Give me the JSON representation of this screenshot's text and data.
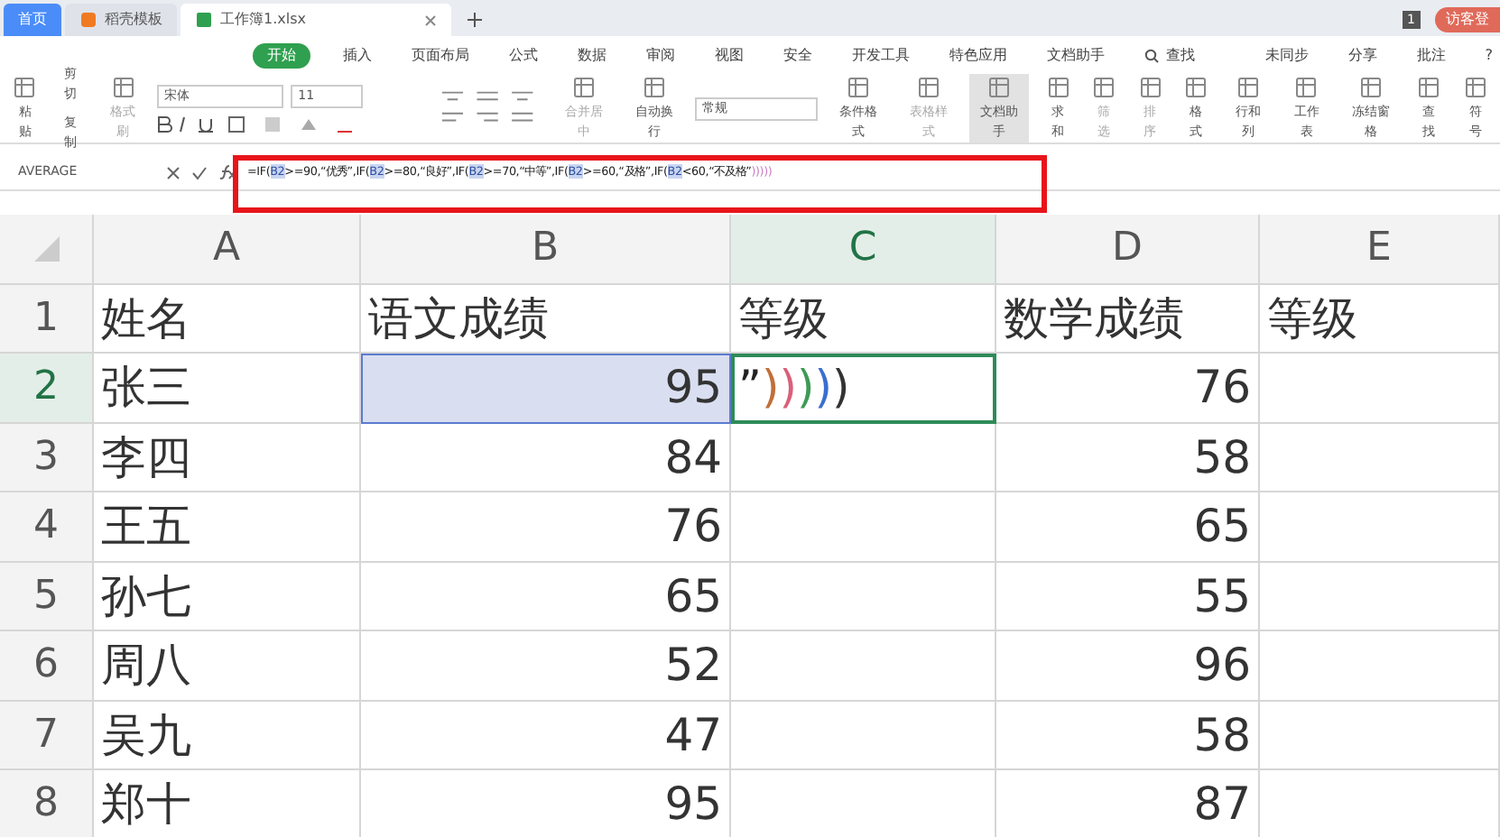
{
  "tabs": [
    {
      "label": "首页",
      "selected": false,
      "kind": "home"
    },
    {
      "label": "稻壳模板",
      "selected": false,
      "kind": "doc"
    },
    {
      "label": "工作簿1.xlsx",
      "selected": true,
      "kind": "sheet"
    }
  ],
  "account": {
    "badge": "1",
    "login": "访客登"
  },
  "menu": [
    {
      "label": "开始",
      "selected": true
    },
    {
      "label": "插入",
      "selected": false
    },
    {
      "label": "页面布局",
      "selected": false
    },
    {
      "label": "公式",
      "selected": false
    },
    {
      "label": "数据",
      "selected": false
    },
    {
      "label": "审阅",
      "selected": false
    },
    {
      "label": "视图",
      "selected": false
    },
    {
      "label": "安全",
      "selected": false
    },
    {
      "label": "开发工具",
      "selected": false
    },
    {
      "label": "特色应用",
      "selected": false
    },
    {
      "label": "文档助手",
      "selected": false
    }
  ],
  "search_menu": "查找",
  "menu_right": [
    "未同步",
    "分享",
    "批注",
    "?"
  ],
  "clipboard": {
    "paste": "粘贴",
    "cut": "剪切",
    "copy": "复制",
    "painter": "格式刷"
  },
  "font": {
    "name": "宋体",
    "size": "11"
  },
  "align": {
    "merge": "合并居中",
    "wrap": "自动换行"
  },
  "number_format": "常规",
  "tools": [
    {
      "label": "条件格式",
      "selected": false,
      "disabled": false
    },
    {
      "label": "表格样式",
      "selected": false,
      "disabled": true
    },
    {
      "label": "文档助手",
      "selected": true,
      "disabled": false
    },
    {
      "label": "求和",
      "selected": false,
      "disabled": false
    },
    {
      "label": "筛选",
      "selected": false,
      "disabled": true
    },
    {
      "label": "排序",
      "selected": false,
      "disabled": true
    },
    {
      "label": "格式",
      "selected": false,
      "disabled": false
    },
    {
      "label": "行和列",
      "selected": false,
      "disabled": false
    },
    {
      "label": "工作表",
      "selected": false,
      "disabled": false
    },
    {
      "label": "冻结窗格",
      "selected": false,
      "disabled": false
    },
    {
      "label": "查找",
      "selected": false,
      "disabled": false
    },
    {
      "label": "符号",
      "selected": false,
      "disabled": false
    }
  ],
  "name_box": "AVERAGE",
  "formula": [
    {
      "text": "=IF(",
      "kind": "text"
    },
    {
      "text": "B2",
      "kind": "ref"
    },
    {
      "text": ">=90,“优秀”,IF(",
      "kind": "text"
    },
    {
      "text": "B2",
      "kind": "ref"
    },
    {
      "text": ">=80,“良好”,IF(",
      "kind": "text"
    },
    {
      "text": "B2",
      "kind": "ref"
    },
    {
      "text": ">=70,“中等”,IF(",
      "kind": "text"
    },
    {
      "text": "B2",
      "kind": "ref"
    },
    {
      "text": ">=60,“及格”,IF(",
      "kind": "text"
    },
    {
      "text": "B2",
      "kind": "ref"
    },
    {
      "text": "<60,“不及格”",
      "kind": "text"
    },
    {
      "text": ")))))",
      "kind": "paren",
      "color": "#c87fc0"
    }
  ],
  "columns": [
    {
      "label": "A",
      "selected": false
    },
    {
      "label": "B",
      "selected": false
    },
    {
      "label": "C",
      "selected": true
    },
    {
      "label": "D",
      "selected": false
    },
    {
      "label": "E",
      "selected": false
    }
  ],
  "rows": [
    {
      "number": "1",
      "selected": false,
      "cells": [
        "姓名",
        "语文成绩",
        "等级",
        "数学成绩",
        "等级"
      ]
    },
    {
      "number": "2",
      "selected": true,
      "cells": [
        "张三",
        "95",
        "",
        "76",
        ""
      ]
    },
    {
      "number": "3",
      "selected": false,
      "cells": [
        "李四",
        "84",
        "",
        "58",
        ""
      ]
    },
    {
      "number": "4",
      "selected": false,
      "cells": [
        "王五",
        "76",
        "",
        "65",
        ""
      ]
    },
    {
      "number": "5",
      "selected": false,
      "cells": [
        "孙七",
        "65",
        "",
        "55",
        ""
      ]
    },
    {
      "number": "6",
      "selected": false,
      "cells": [
        "周八",
        "52",
        "",
        "96",
        ""
      ]
    },
    {
      "number": "7",
      "selected": false,
      "cells": [
        "吴九",
        "47",
        "",
        "58",
        ""
      ]
    },
    {
      "number": "8",
      "selected": false,
      "cells": [
        "郑十",
        "95",
        "",
        "87",
        ""
      ]
    }
  ],
  "editing_cell": [
    {
      "text": "”",
      "color": "#222222"
    },
    {
      "text": ")",
      "color": "#c0703a"
    },
    {
      "text": ")",
      "color": "#d9607a"
    },
    {
      "text": ")",
      "color": "#3f9a55"
    },
    {
      "text": ")",
      "color": "#3a6fd0"
    },
    {
      "text": ")",
      "color": "#333333"
    }
  ]
}
